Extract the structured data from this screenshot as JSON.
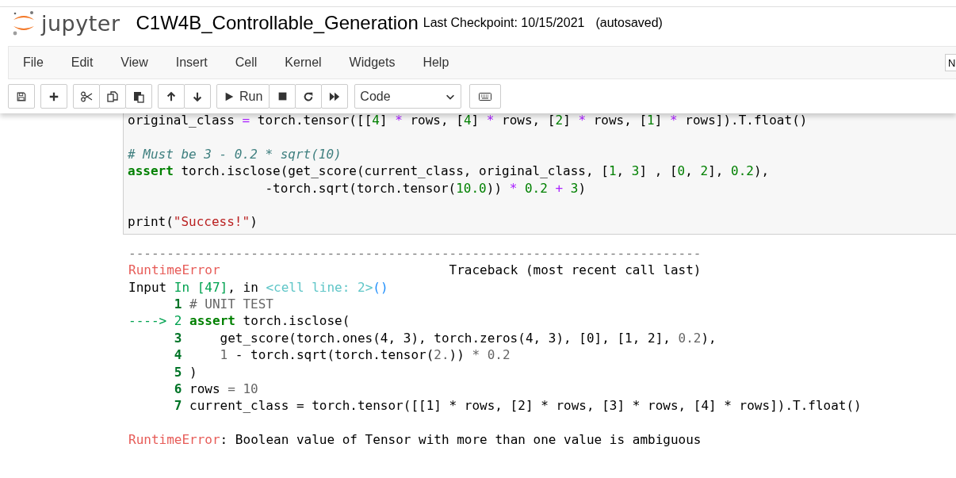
{
  "header": {
    "logo_text": "jupyter",
    "notebook_name": "C1W4B_Controllable_Generation",
    "checkpoint": "Last Checkpoint: 10/15/2021",
    "autosave": "(autosaved)"
  },
  "menu": [
    "File",
    "Edit",
    "View",
    "Insert",
    "Cell",
    "Kernel",
    "Widgets",
    "Help"
  ],
  "kernel_indicator": "N",
  "toolbar": {
    "run_label": "Run",
    "cell_type": "Code"
  },
  "code_cell": {
    "blocks": [
      [
        [
          {
            "kind": "plain",
            "text": "original_class "
          },
          {
            "kind": "op",
            "text": "="
          },
          {
            "kind": "plain",
            "text": " torch.tensor([["
          },
          {
            "kind": "num",
            "text": "4"
          },
          {
            "kind": "plain",
            "text": "] "
          },
          {
            "kind": "op",
            "text": "*"
          },
          {
            "kind": "plain",
            "text": " rows, ["
          },
          {
            "kind": "num",
            "text": "4"
          },
          {
            "kind": "plain",
            "text": "] "
          },
          {
            "kind": "op",
            "text": "*"
          },
          {
            "kind": "plain",
            "text": " rows, ["
          },
          {
            "kind": "num",
            "text": "2"
          },
          {
            "kind": "plain",
            "text": "] "
          },
          {
            "kind": "op",
            "text": "*"
          },
          {
            "kind": "plain",
            "text": " rows, ["
          },
          {
            "kind": "num",
            "text": "1"
          },
          {
            "kind": "plain",
            "text": "] "
          },
          {
            "kind": "op",
            "text": "*"
          },
          {
            "kind": "plain",
            "text": " rows]).T.float()"
          }
        ]
      ],
      [
        [
          {
            "kind": "comment",
            "text": "# Must be 3 - 0.2 * sqrt(10)"
          }
        ],
        [
          {
            "kind": "kw",
            "text": "assert"
          },
          {
            "kind": "plain",
            "text": " torch.isclose(get_score(current_class, original_class, ["
          },
          {
            "kind": "num",
            "text": "1"
          },
          {
            "kind": "plain",
            "text": ", "
          },
          {
            "kind": "num",
            "text": "3"
          },
          {
            "kind": "plain",
            "text": "] , ["
          },
          {
            "kind": "num",
            "text": "0"
          },
          {
            "kind": "plain",
            "text": ", "
          },
          {
            "kind": "num",
            "text": "2"
          },
          {
            "kind": "plain",
            "text": "], "
          },
          {
            "kind": "num",
            "text": "0.2"
          },
          {
            "kind": "plain",
            "text": "),"
          }
        ],
        [
          {
            "kind": "plain",
            "text": "                  -torch.sqrt(torch.tensor("
          },
          {
            "kind": "num",
            "text": "10.0"
          },
          {
            "kind": "plain",
            "text": ")) "
          },
          {
            "kind": "op",
            "text": "* "
          },
          {
            "kind": "num",
            "text": "0.2"
          },
          {
            "kind": "op",
            "text": " + "
          },
          {
            "kind": "num",
            "text": "3"
          },
          {
            "kind": "plain",
            "text": ")"
          }
        ]
      ],
      [
        [
          {
            "kind": "plain",
            "text": "print("
          },
          {
            "kind": "str",
            "text": "\"Success!\""
          },
          {
            "kind": "plain",
            "text": ")"
          }
        ]
      ]
    ]
  },
  "traceback": {
    "separator": "---------------------------------------------------------------------------",
    "header": [
      {
        "kind": "err",
        "text": "RuntimeError"
      },
      {
        "kind": "plain",
        "text": "                              Traceback (most recent call last)"
      }
    ],
    "input": [
      {
        "kind": "plain",
        "text": "Input "
      },
      {
        "kind": "input",
        "text": "In [47]"
      },
      {
        "kind": "plain",
        "text": ", in "
      },
      {
        "kind": "cell",
        "text": "<cell line: 2>"
      },
      {
        "kind": "paren",
        "text": "()"
      }
    ],
    "lines": [
      {
        "number": "1",
        "current": false,
        "code": [
          {
            "kind": "muted",
            "text": "# UNIT TEST"
          }
        ]
      },
      {
        "number": "2",
        "current": true,
        "code": [
          {
            "kind": "kw",
            "text": "assert"
          },
          {
            "kind": "plain",
            "text": " torch.isclose("
          }
        ]
      },
      {
        "number": "3",
        "current": false,
        "code": [
          {
            "kind": "plain",
            "text": "    get_score(torch.ones(4, 3), torch.zeros(4, 3), [0], [1, 2], "
          },
          {
            "kind": "muted",
            "text": "0.2"
          },
          {
            "kind": "plain",
            "text": "),"
          }
        ]
      },
      {
        "number": "4",
        "current": false,
        "code": [
          {
            "kind": "muted",
            "text": "    1"
          },
          {
            "kind": "plain",
            "text": " - torch.sqrt(torch.tensor("
          },
          {
            "kind": "muted",
            "text": "2."
          },
          {
            "kind": "plain",
            "text": ")) "
          },
          {
            "kind": "muted",
            "text": "* 0.2"
          }
        ]
      },
      {
        "number": "5",
        "current": false,
        "code": [
          {
            "kind": "plain",
            "text": ")"
          }
        ]
      },
      {
        "number": "6",
        "current": false,
        "code": [
          {
            "kind": "plain",
            "text": "rows "
          },
          {
            "kind": "muted",
            "text": "= 10"
          }
        ]
      },
      {
        "number": "7",
        "current": false,
        "code": [
          {
            "kind": "plain",
            "text": "current_class = torch.tensor([[1] * rows, [2] * rows, [3] * rows, [4] * rows]).T.float()"
          }
        ]
      }
    ],
    "arrow": "---->",
    "error": [
      {
        "kind": "err",
        "text": "RuntimeError"
      },
      {
        "kind": "plain",
        "text": ": Boolean value of Tensor with more than one value is ambiguous"
      }
    ]
  }
}
